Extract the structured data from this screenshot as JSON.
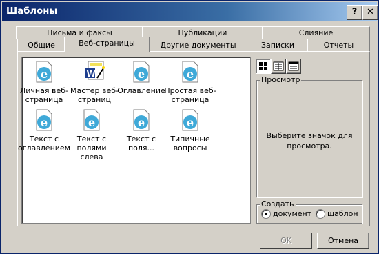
{
  "window": {
    "title": "Шаблоны",
    "help_label": "?",
    "close_label": "✕"
  },
  "tabs": {
    "row1": [
      "Письма и факсы",
      "Публикации",
      "Слияние"
    ],
    "row2": [
      "Общие",
      "Веб-страницы",
      "Другие документы",
      "Записки",
      "Отчеты"
    ],
    "active": "Веб-страницы"
  },
  "templates": [
    {
      "label": "Личная веб-страница",
      "icon": "ie-document-icon"
    },
    {
      "label": "Мастер веб-страниц",
      "icon": "word-wizard-icon"
    },
    {
      "label": "Оглавление",
      "icon": "ie-document-icon"
    },
    {
      "label": "Простая веб-страница",
      "icon": "ie-document-icon"
    },
    {
      "label": "Текст с оглавлением",
      "icon": "ie-document-icon"
    },
    {
      "label": "Текст с полями слева",
      "icon": "ie-document-icon"
    },
    {
      "label": "Текст с поля...",
      "icon": "ie-document-icon"
    },
    {
      "label": "Типичные вопросы",
      "icon": "ie-document-icon"
    }
  ],
  "view_buttons": [
    "large-icons-view-icon",
    "list-view-icon",
    "details-view-icon"
  ],
  "preview": {
    "legend": "Просмотр",
    "text": "Выберите значок для просмотра."
  },
  "create": {
    "legend": "Создать",
    "options": [
      "документ",
      "шаблон"
    ],
    "selected": "документ"
  },
  "buttons": {
    "ok": "OK",
    "cancel": "Отмена"
  }
}
